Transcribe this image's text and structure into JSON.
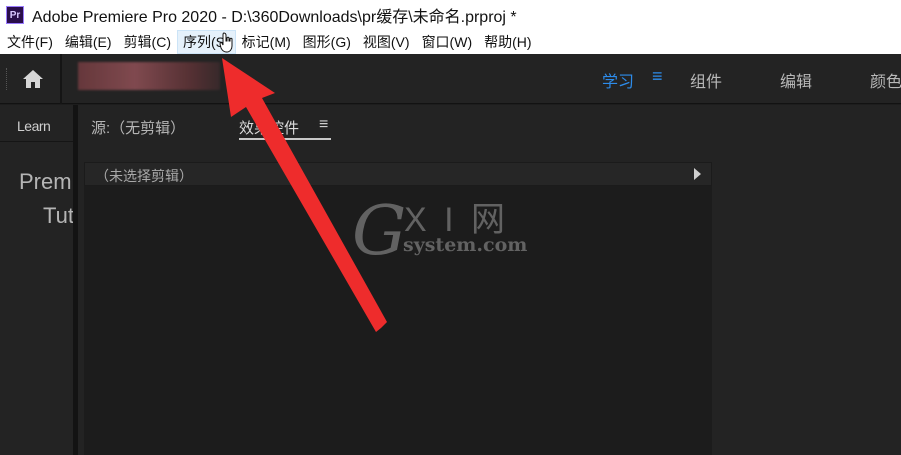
{
  "window": {
    "app_icon_text": "Pr",
    "title": "Adobe Premiere Pro 2020 - D:\\360Downloads\\pr缓存\\未命名.prproj *"
  },
  "menu": {
    "items": [
      "文件(F)",
      "编辑(E)",
      "剪辑(C)",
      "序列(S)",
      "标记(M)",
      "图形(G)",
      "视图(V)",
      "窗口(W)",
      "帮助(H)"
    ],
    "active_index": 3
  },
  "workspace": {
    "tabs": [
      "学习",
      "组件",
      "编辑",
      "颜色"
    ],
    "active": "学习",
    "menu_icon": "hamburger-icon",
    "accent_color": "#2d8ceb"
  },
  "left_panel": {
    "tab": "Learn",
    "text_line1": "Prem",
    "text_line2": "Tut"
  },
  "main_panel": {
    "source_tab": "源:（无剪辑）",
    "effects_tab": "效果控件",
    "effects_menu_icon": "≡",
    "clip_header": "（未选择剪辑）"
  },
  "watermark": {
    "top": "X I 网",
    "bottom": "system.com",
    "letter": "G"
  }
}
